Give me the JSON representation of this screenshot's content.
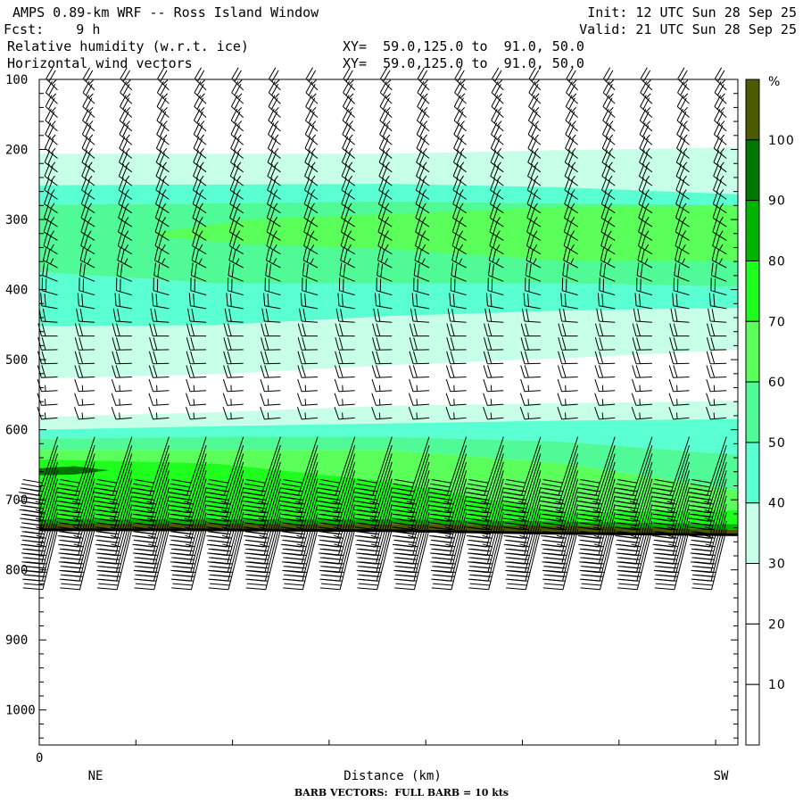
{
  "header": {
    "title": "AMPS 0.89-km WRF -- Ross Island Window",
    "init": "Init: 12 UTC Sun 28 Sep 25",
    "fcst": "Fcst:    9 h",
    "valid": "Valid: 21 UTC Sun 28 Sep 25",
    "field1": "Relative humidity (w.r.t. ice)",
    "field1_xy": "XY=  59.0,125.0 to  91.0, 50.0",
    "field2": "Horizontal wind vectors",
    "field2_xy": "XY=  59.0,125.0 to  91.0, 50.0"
  },
  "footer": {
    "barb_note": "BARB VECTORS:  FULL BARB = 10 kts"
  },
  "chart_data": {
    "type": "heatmap",
    "title": "Relative humidity (w.r.t. ice) cross-section with horizontal wind barbs",
    "xlabel": "Distance (km)",
    "x_start_label": "0",
    "x_left_end": "NE",
    "x_right_end": "SW",
    "ylim": [
      100,
      1050
    ],
    "yticks": [
      "100",
      "200",
      "300",
      "400",
      "500",
      "600",
      "700",
      "800",
      "900",
      "1000"
    ],
    "x_fraction_samples": [
      0,
      0.25,
      0.5,
      0.75,
      1
    ],
    "boundaries_hPa": [
      [
        206,
        206,
        206,
        201,
        197
      ],
      [
        251,
        250,
        249,
        254,
        264
      ],
      [
        279,
        277,
        274,
        277,
        279
      ],
      [
        375,
        391,
        391,
        391,
        396
      ],
      [
        452,
        451,
        438,
        430,
        426
      ],
      [
        527,
        521,
        508,
        498,
        486
      ],
      [
        582,
        575,
        566,
        562,
        559
      ],
      [
        600,
        595,
        591,
        587,
        585
      ],
      [
        613,
        610,
        610,
        617,
        636
      ],
      [
        629,
        629,
        629,
        648,
        687
      ],
      [
        642,
        648,
        674,
        718,
        715
      ],
      [
        728,
        728,
        728,
        731,
        735
      ],
      [
        734,
        734,
        735,
        737,
        743
      ],
      [
        743,
        743,
        744,
        748,
        750
      ]
    ],
    "band_levels": [
      "30-40",
      "40-50",
      "50-60",
      "40-50",
      "30-40",
      "<30",
      "30-40",
      "40-50",
      "50-60",
      "60-70",
      "70-80",
      "80-90",
      ">100"
    ],
    "patches": [
      {
        "level": "60-70",
        "points": [
          [
            0.17,
            318
          ],
          [
            0.3,
            300
          ],
          [
            0.5,
            292
          ],
          [
            0.75,
            282
          ],
          [
            1,
            280
          ],
          [
            1,
            359
          ],
          [
            0.75,
            359
          ],
          [
            0.5,
            342
          ],
          [
            0.3,
            335
          ],
          [
            0.17,
            325
          ]
        ]
      },
      {
        "level": "90-100",
        "points": [
          [
            0,
            655
          ],
          [
            0.05,
            652
          ],
          [
            0.1,
            658
          ],
          [
            0.05,
            664
          ],
          [
            0,
            665
          ]
        ]
      }
    ],
    "colorbar": {
      "unit": "%",
      "levels": [
        ">100",
        "90-100",
        "80-90",
        "70-80",
        "60-70",
        "50-60",
        "40-50",
        "30-40",
        "20-30",
        "10-20",
        "<10"
      ],
      "colors": [
        "#4c5a00",
        "#007800",
        "#00b400",
        "#1eff1e",
        "#5aff5a",
        "#50fa96",
        "#5affd2",
        "#c8ffe8",
        "#ffffff",
        "#ffffff",
        "#ffffff"
      ],
      "labels": [
        "100",
        "90",
        "80",
        "70",
        "60",
        "50",
        "40",
        "30",
        "20",
        "10"
      ]
    },
    "wind_profile": [
      {
        "p": 100,
        "dir": 315,
        "kts": 25
      },
      {
        "p": 350,
        "dir": 300,
        "kts": 25
      },
      {
        "p": 400,
        "dir": 285,
        "kts": 20
      },
      {
        "p": 450,
        "dir": 270,
        "kts": 20
      },
      {
        "p": 580,
        "dir": 265,
        "kts": 15
      },
      {
        "p": 600,
        "dir": 200,
        "kts": 40
      },
      {
        "p": 740,
        "dir": 195,
        "kts": 50
      }
    ]
  }
}
